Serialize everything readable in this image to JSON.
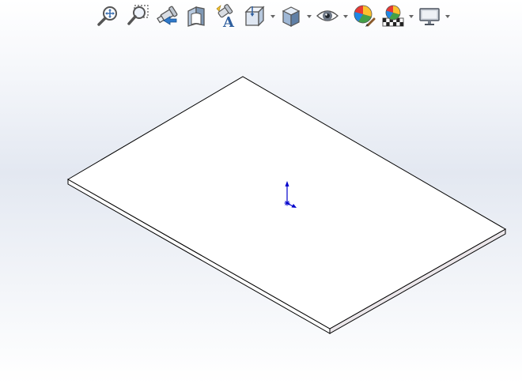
{
  "window": {
    "background_top": "#ffffff",
    "background_mid": "#e3e8f1"
  },
  "toolbar": {
    "items": [
      {
        "id": "zoom-to-fit",
        "icon": "zoom-to-fit-icon",
        "has_dropdown": false
      },
      {
        "id": "zoom-to-area",
        "icon": "zoom-to-area-icon",
        "has_dropdown": false
      },
      {
        "id": "previous-view",
        "icon": "previous-view-icon",
        "has_dropdown": false
      },
      {
        "id": "section-view",
        "icon": "section-view-icon",
        "has_dropdown": false
      },
      {
        "id": "dynamic-annotation-views",
        "icon": "dynamic-annotation-icon",
        "has_dropdown": false
      },
      {
        "id": "view-orientation",
        "icon": "view-orientation-icon",
        "has_dropdown": true
      },
      {
        "id": "display-style",
        "icon": "display-style-icon",
        "has_dropdown": true
      },
      {
        "id": "hide-show-items",
        "icon": "eye-icon",
        "has_dropdown": true
      },
      {
        "id": "edit-appearance",
        "icon": "edit-appearance-icon",
        "has_dropdown": false
      },
      {
        "id": "apply-scene",
        "icon": "apply-scene-icon",
        "has_dropdown": true
      },
      {
        "id": "view-settings",
        "icon": "monitor-icon",
        "has_dropdown": true
      }
    ]
  },
  "model": {
    "type": "thin-plate",
    "top_face_color": "#ffffff",
    "edge_color": "#000000",
    "side_face_color": "#ebe6ea"
  },
  "triad": {
    "axis_color": "#0000cc"
  }
}
